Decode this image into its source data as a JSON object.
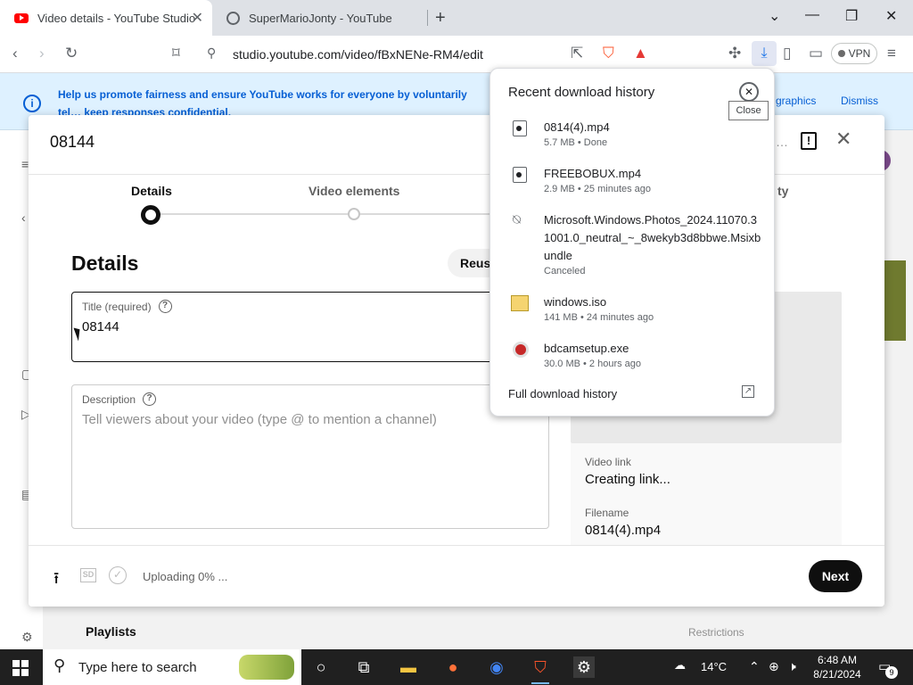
{
  "browser": {
    "tabs": [
      {
        "title": "Video details - YouTube Studio",
        "active": true
      },
      {
        "title": "SuperMarioJonty - YouTube",
        "active": false
      }
    ],
    "url": "studio.youtube.com/video/fBxNENe-RM4/edit",
    "vpn_label": "VPN"
  },
  "banner": {
    "message": "Help us promote fairness and ensure YouTube works for everyone by voluntarily tel… keep responses confidential.",
    "infographics": "graphics",
    "dismiss": "Dismiss"
  },
  "page": {
    "playlists": "Playlists",
    "restrictions": "Restrictions"
  },
  "modal": {
    "title": "08144",
    "steps": [
      "Details",
      "Video elements",
      "ty"
    ],
    "details_heading": "Details",
    "reuse_label": "Reus",
    "title_field": {
      "label": "Title (required)",
      "value": "08144"
    },
    "description_field": {
      "label": "Description",
      "placeholder": "Tell viewers about your video (type @ to mention a channel)"
    },
    "video_link_label": "Video link",
    "video_link_value": "Creating link...",
    "filename_label": "Filename",
    "filename_value": "0814(4).mp4",
    "upload_status": "Uploading 0% ...",
    "sd_badge": "SD",
    "next_label": "Next"
  },
  "downloads": {
    "heading": "Recent download history",
    "close_tooltip": "Close",
    "items": [
      {
        "name": "0814(4).mp4",
        "meta": "5.7 MB • Done",
        "icon": "video-file-icon"
      },
      {
        "name": "FREEBOBUX.mp4",
        "meta": "2.9 MB • 25 minutes ago",
        "icon": "video-file-icon"
      },
      {
        "name": "Microsoft.Windows.Photos_2024.11070.31001.0_neutral_~_8wekyb3d8bbwe.Msixbundle",
        "meta": "Canceled",
        "icon": "cancelled-download-icon"
      },
      {
        "name": "windows.iso",
        "meta": "141 MB • 24 minutes ago",
        "icon": "disc-image-icon"
      },
      {
        "name": "bdcamsetup.exe",
        "meta": "30.0 MB • 2 hours ago",
        "icon": "installer-icon"
      }
    ],
    "full_history": "Full download history"
  },
  "taskbar": {
    "search_placeholder": "Type here to search",
    "temperature": "14°C",
    "time": "6:48 AM",
    "date": "8/21/2024",
    "notification_count": "9"
  }
}
